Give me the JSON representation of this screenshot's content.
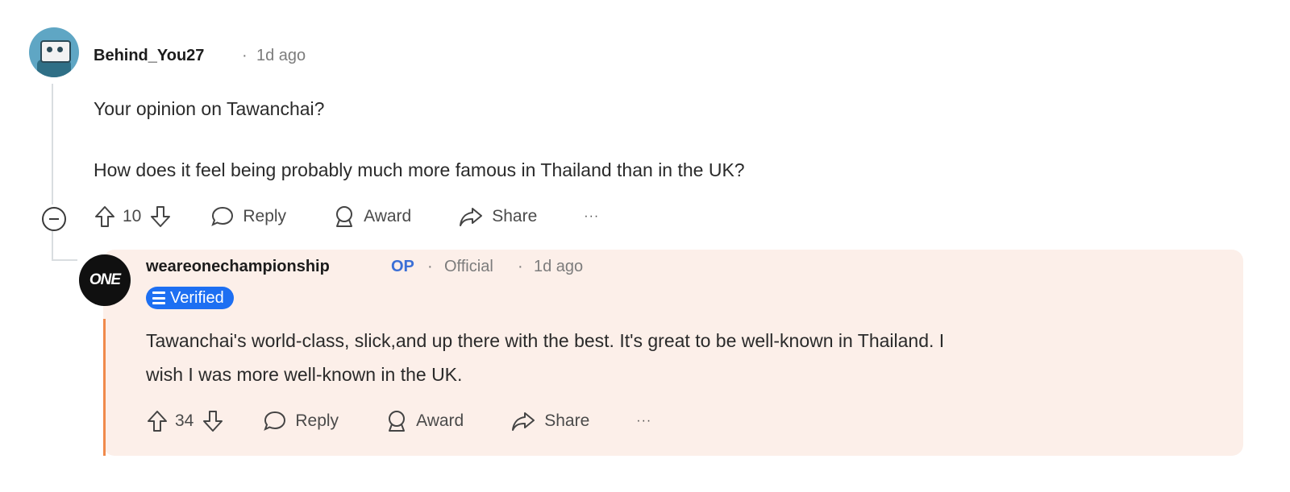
{
  "comment": {
    "username": "Behind_You27",
    "separator": "·",
    "time": "1d ago",
    "paragraph1": "Your opinion on Tawanchai?",
    "paragraph2": "How does it feel being probably much more famous in Thailand than in the UK?",
    "votes": "10",
    "reply_label": "Reply",
    "award_label": "Award",
    "share_label": "Share",
    "more_label": "···"
  },
  "reply": {
    "avatar_text": "ONE",
    "username": "weareonechampionship",
    "op_tag": "OP",
    "separator1": "·",
    "flair": "Official",
    "separator2": "·",
    "time": "1d ago",
    "verified_label": "Verified",
    "body_line1": "Tawanchai's world-class, slick,and up there with the best. It's great to be well-known in Thailand. I",
    "body_line2": "wish I was more well-known in the UK.",
    "votes": "34",
    "reply_label": "Reply",
    "award_label": "Award",
    "share_label": "Share",
    "more_label": "···"
  },
  "colors": {
    "op_accent": "#f08a4b",
    "op_tag": "#3b6fd6",
    "verified_badge": "#1d6ff2",
    "reply_card_bg": "#fcefe9"
  }
}
